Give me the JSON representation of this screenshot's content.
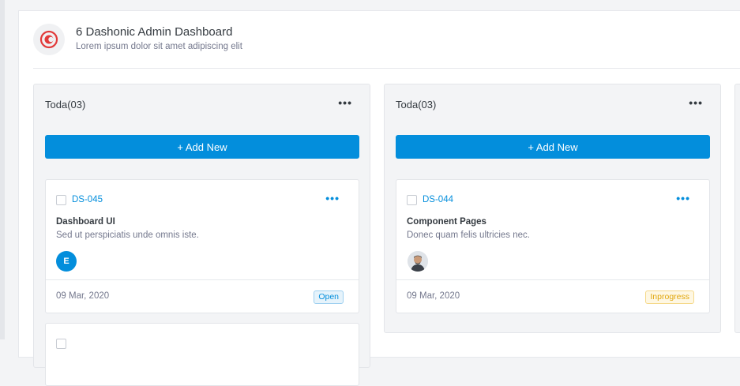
{
  "project": {
    "title": "6 Dashonic Admin Dashboard",
    "subtitle": "Lorem ipsum dolor sit amet adipiscing elit",
    "logo_icon": "logo-icon"
  },
  "columns": [
    {
      "title": "Toda(03)",
      "menu": "•••",
      "add_label": "+ Add New",
      "task": {
        "id": "DS-045",
        "menu": "•••",
        "name": "Dashboard UI",
        "description": "Sed ut perspiciatis unde omnis iste.",
        "avatar_letter": "E",
        "date": "09 Mar, 2020",
        "status": "Open",
        "status_color": "#038edc"
      }
    },
    {
      "title": "Toda(03)",
      "menu": "•••",
      "add_label": "+ Add New",
      "task": {
        "id": "DS-044",
        "menu": "•••",
        "name": "Component Pages",
        "description": "Donec quam felis ultricies nec.",
        "avatar_icon": "user-avatar",
        "date": "09 Mar, 2020",
        "status": "Inprogress",
        "status_color": "#e0a60b"
      }
    }
  ],
  "colors": {
    "primary": "#038edc",
    "brand_red": "#e23a3a"
  }
}
